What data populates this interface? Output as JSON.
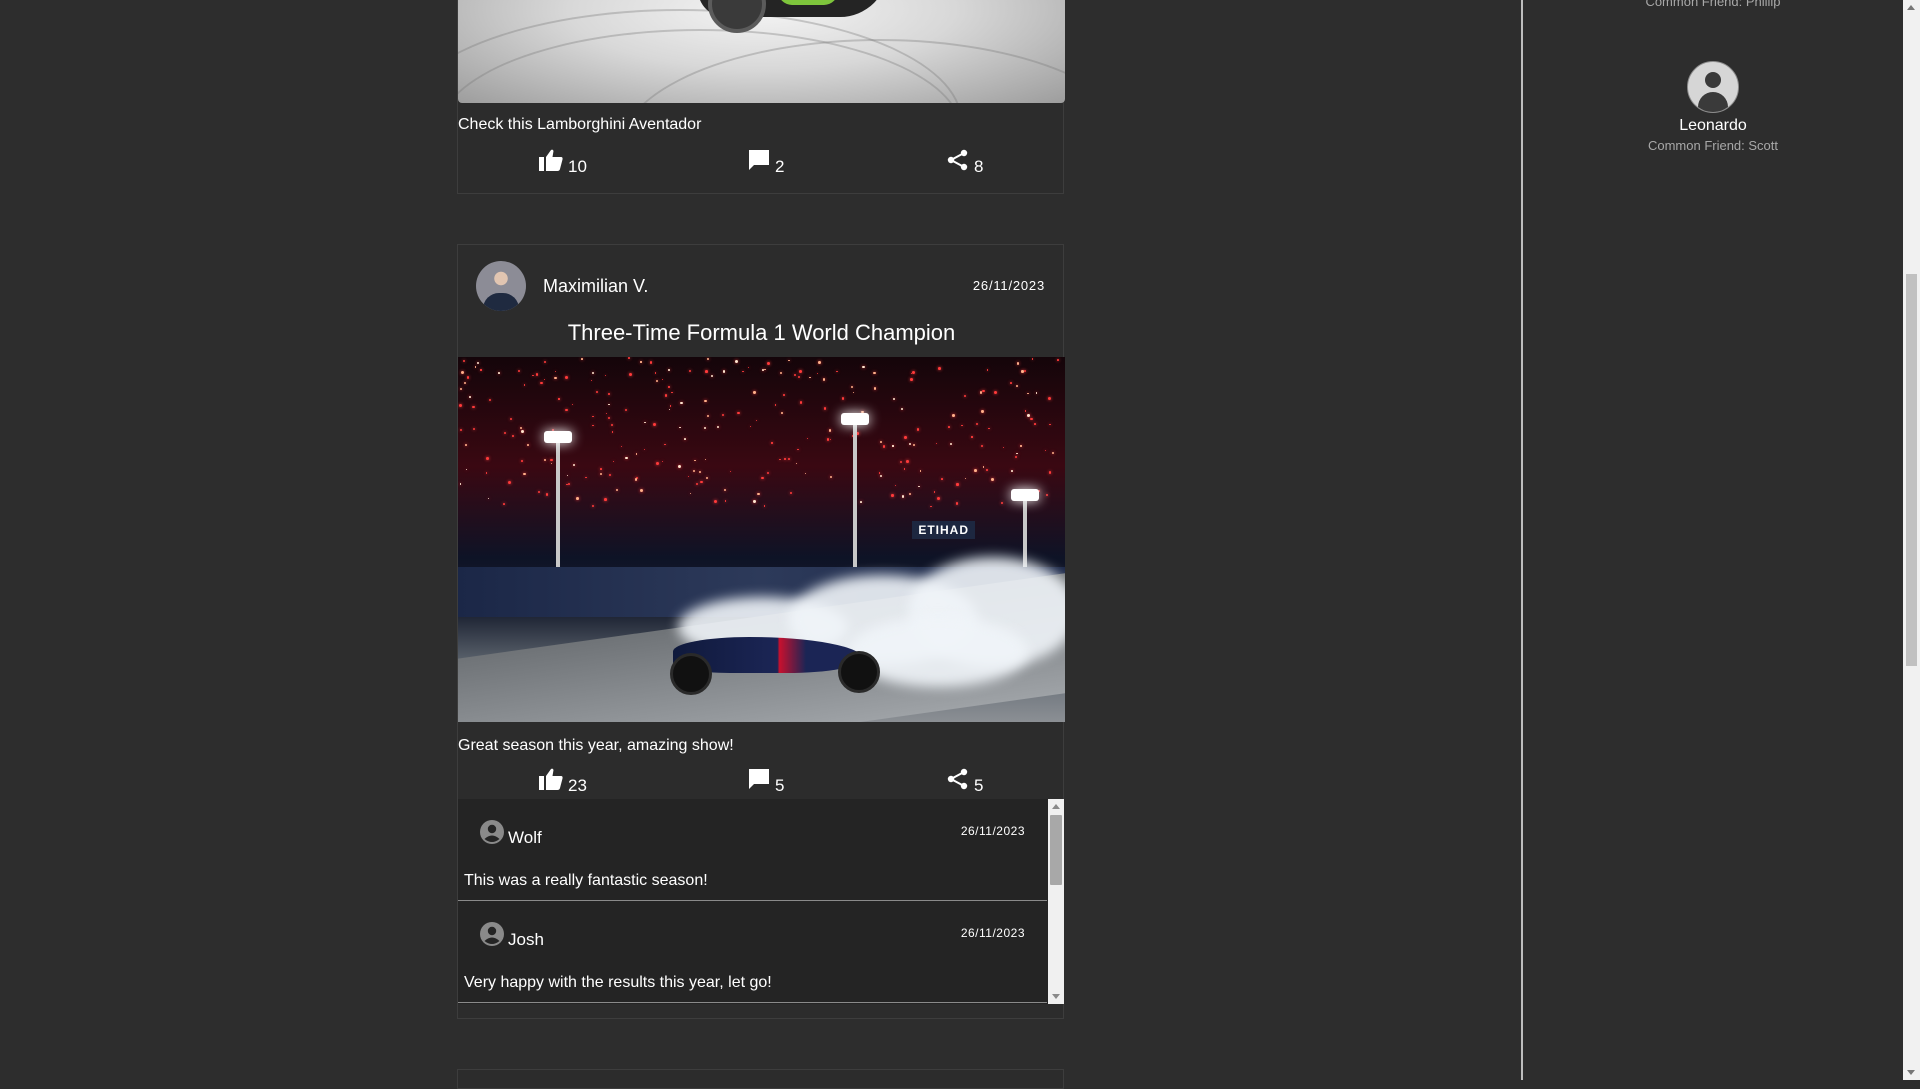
{
  "feed": {
    "posts": [
      {
        "caption": "Check this Lamborghini Aventador",
        "likes": "10",
        "comments": "2",
        "shares": "8"
      },
      {
        "author": "Maximilian V.",
        "date": "26/11/2023",
        "title": "Three-Time Formula 1 World Champion",
        "caption": "Great season this year, amazing show!",
        "likes": "23",
        "comments": "5",
        "shares": "5",
        "comment_list": [
          {
            "name": "Wolf",
            "date": "26/11/2023",
            "text": "This was a really fantastic season!"
          },
          {
            "name": "Josh",
            "date": "26/11/2023",
            "text": "Very happy with the results this year, let go!"
          }
        ]
      }
    ]
  },
  "suggestions": {
    "previous_common_friend": "Common Friend: Phillip",
    "items": [
      {
        "name": "Leonardo",
        "common": "Common Friend: Scott"
      }
    ]
  },
  "icons": {
    "like": "thumb-up-icon",
    "comment": "comment-icon",
    "share": "share-icon",
    "user": "account-circle-icon"
  },
  "colors": {
    "background": "#2d2d2d",
    "comment_panel": "#242424",
    "text": "#ffffff",
    "muted": "#a8a8a8"
  }
}
